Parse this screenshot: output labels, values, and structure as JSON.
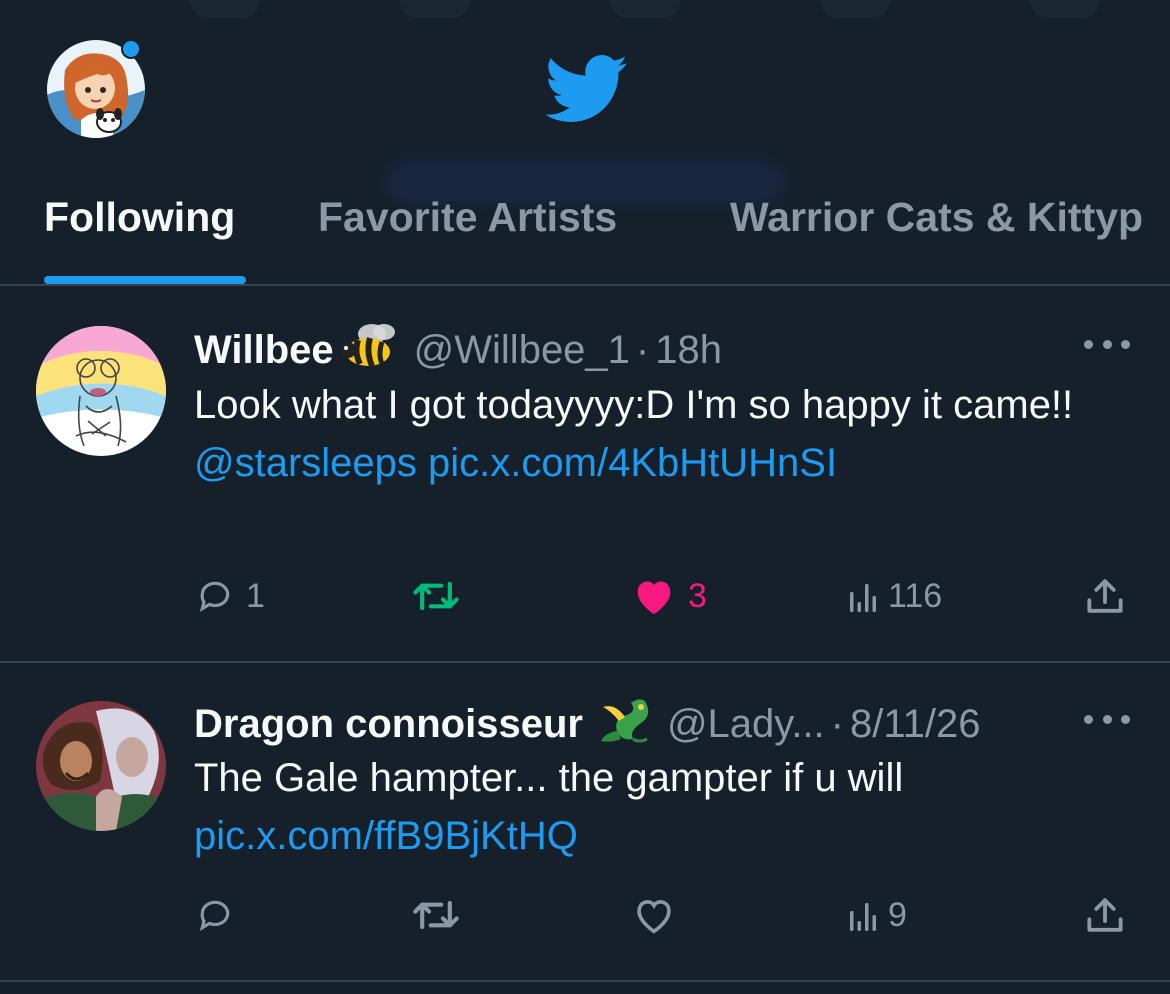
{
  "theme": {
    "background": "#15202b",
    "text_primary": "#f7f9f9",
    "text_secondary": "#8b98a5",
    "accent": "#1d9bf0",
    "divider": "#38444d",
    "retweet_green": "#00ba7c",
    "like_pink": "#f91880"
  },
  "header": {
    "profile_avatar_icon": "profile-avatar",
    "logo_icon": "twitter-bird-icon",
    "notification_dot": true
  },
  "tabs": [
    {
      "label": "Following",
      "active": true
    },
    {
      "label": "Favorite Artists",
      "active": false
    },
    {
      "label": "Warrior Cats & Kittyp",
      "active": false
    }
  ],
  "tweets": [
    {
      "name": "Willbee",
      "name_emoji": "bee",
      "handle": "@Willbee_1",
      "separator": "·",
      "time": "18h",
      "text": "Look what I got todayyyy:D I'm so happy it came!!",
      "mention": "@starsleeps",
      "link": "pic.x.com/4KbHtUHnSI",
      "actions": {
        "reply_count": "1",
        "retweet_count": "",
        "retweet_active": true,
        "like_count": "3",
        "like_active": true,
        "views_count": "116"
      }
    },
    {
      "name": "Dragon connoisseur",
      "name_emoji": "dragon",
      "handle": "@Lady...",
      "separator": "·",
      "time": "8/11/26",
      "text": "The Gale hampter... the gampter if u will",
      "mention": "",
      "link": "pic.x.com/ffB9BjKtHQ",
      "actions": {
        "reply_count": "",
        "retweet_count": "",
        "retweet_active": false,
        "like_count": "",
        "like_active": false,
        "views_count": "9"
      }
    }
  ]
}
